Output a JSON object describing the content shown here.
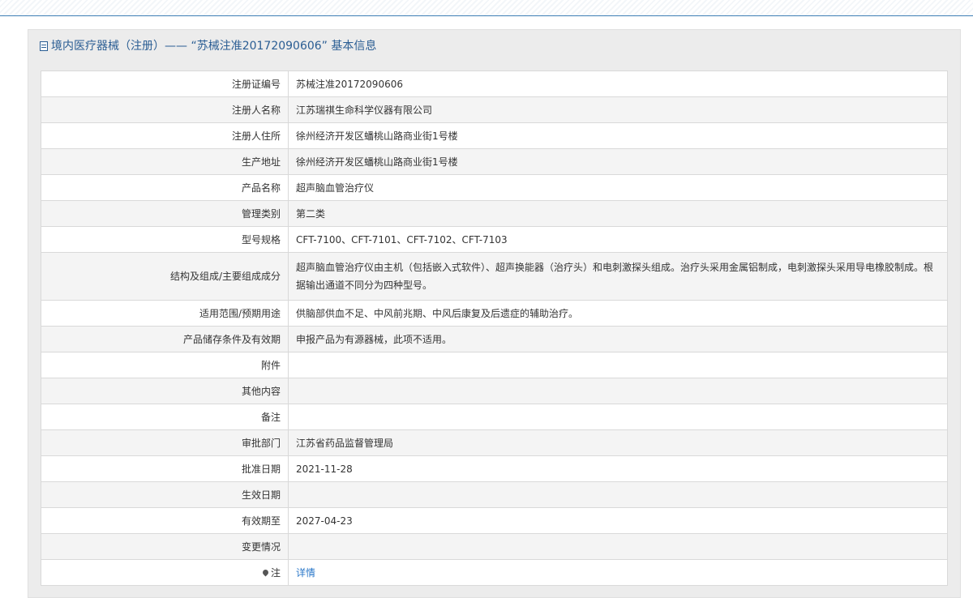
{
  "header": {
    "title": "境内医疗器械（注册）—— “苏械注准20172090606” 基本信息"
  },
  "rows": [
    {
      "label": "注册证编号",
      "value": "苏械注准20172090606"
    },
    {
      "label": "注册人名称",
      "value": "江苏瑞祺生命科学仪器有限公司"
    },
    {
      "label": "注册人住所",
      "value": "徐州经济开发区蟠桃山路商业街1号楼"
    },
    {
      "label": "生产地址",
      "value": "徐州经济开发区蟠桃山路商业街1号楼"
    },
    {
      "label": "产品名称",
      "value": "超声脑血管治疗仪"
    },
    {
      "label": "管理类别",
      "value": "第二类"
    },
    {
      "label": "型号规格",
      "value": "CFT-7100、CFT-7101、CFT-7102、CFT-7103"
    },
    {
      "label": "结构及组成/主要组成成分",
      "value": "超声脑血管治疗仪由主机（包括嵌入式软件）、超声换能器（治疗头）和电刺激探头组成。治疗头采用金属铝制成，电刺激探头采用导电橡胶制成。根据输出通道不同分为四种型号。"
    },
    {
      "label": "适用范围/预期用途",
      "value": "供脑部供血不足、中风前兆期、中风后康复及后遗症的辅助治疗。"
    },
    {
      "label": "产品储存条件及有效期",
      "value": "申报产品为有源器械，此项不适用。"
    },
    {
      "label": "附件",
      "value": ""
    },
    {
      "label": "其他内容",
      "value": ""
    },
    {
      "label": "备注",
      "value": ""
    },
    {
      "label": "审批部门",
      "value": "江苏省药品监督管理局"
    },
    {
      "label": "批准日期",
      "value": "2021-11-28"
    },
    {
      "label": "生效日期",
      "value": ""
    },
    {
      "label": "有效期至",
      "value": "2027-04-23"
    },
    {
      "label": "变更情况",
      "value": ""
    },
    {
      "label": "注",
      "value": "详情"
    }
  ]
}
